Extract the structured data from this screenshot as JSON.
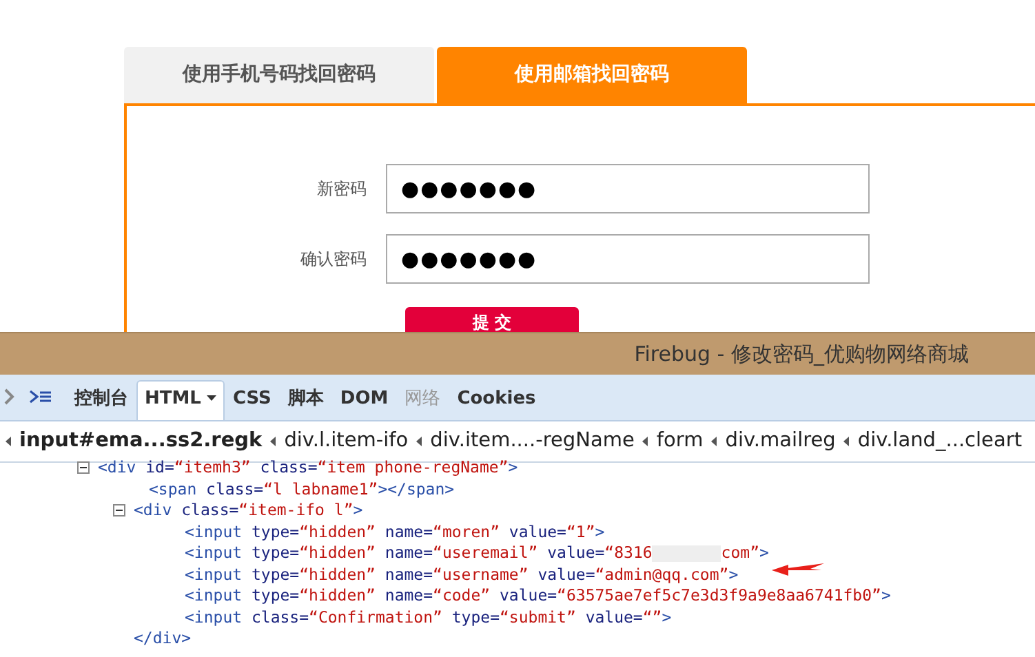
{
  "page": {
    "tabs": [
      {
        "label": "使用手机号码找回密码",
        "selected": false
      },
      {
        "label": "使用邮箱找回密码",
        "selected": true
      }
    ],
    "fields": [
      {
        "label": "新密码",
        "value": "●●●●●●●"
      },
      {
        "label": "确认密码",
        "value": "●●●●●●●"
      }
    ],
    "submit_button": {
      "label": "提 交"
    }
  },
  "firebug": {
    "title": "Firebug - 修改密码_优购物网络商城",
    "tabs": [
      {
        "label": "控制台",
        "selected": false,
        "disabled": false,
        "dropdown": false
      },
      {
        "label": "HTML",
        "selected": true,
        "disabled": false,
        "dropdown": true
      },
      {
        "label": "CSS",
        "selected": false,
        "disabled": false,
        "dropdown": false
      },
      {
        "label": "脚本",
        "selected": false,
        "disabled": false,
        "dropdown": false
      },
      {
        "label": "DOM",
        "selected": false,
        "disabled": false,
        "dropdown": false
      },
      {
        "label": "网络",
        "selected": false,
        "disabled": true,
        "dropdown": false
      },
      {
        "label": "Cookies",
        "selected": false,
        "disabled": false,
        "dropdown": false
      }
    ],
    "breadcrumbs": [
      {
        "label": "input#ema...ss2.regk",
        "selected": true
      },
      {
        "label": "div.l.item-ifo",
        "selected": false
      },
      {
        "label": "div.item....-regName",
        "selected": false
      },
      {
        "label": "form",
        "selected": false
      },
      {
        "label": "div.mailreg",
        "selected": false
      },
      {
        "label": "div.land_...cleart",
        "selected": false
      }
    ],
    "html_tree": [
      {
        "expanded": true,
        "parts": [
          {
            "kind": "tag",
            "text": "<div"
          },
          {
            "kind": "attr",
            "text": " id="
          },
          {
            "kind": "value",
            "text": "“itemh3”"
          },
          {
            "kind": "attr",
            "text": " class="
          },
          {
            "kind": "value",
            "text": "“item phone-regName”"
          },
          {
            "kind": "tag",
            "text": ">"
          }
        ],
        "children": [
          {
            "parts": [
              {
                "kind": "tag",
                "text": "<span"
              },
              {
                "kind": "attr",
                "text": " class="
              },
              {
                "kind": "value",
                "text": "“l labname1”"
              },
              {
                "kind": "tag",
                "text": "></span>"
              }
            ]
          },
          {
            "expanded": true,
            "parts": [
              {
                "kind": "tag",
                "text": "<div"
              },
              {
                "kind": "attr",
                "text": " class="
              },
              {
                "kind": "value",
                "text": "“item-ifo l”"
              },
              {
                "kind": "tag",
                "text": ">"
              }
            ],
            "closing": "</div>",
            "children": [
              {
                "parts": [
                  {
                    "kind": "tag",
                    "text": "<input"
                  },
                  {
                    "kind": "attr",
                    "text": " type="
                  },
                  {
                    "kind": "value",
                    "text": "“hidden”"
                  },
                  {
                    "kind": "attr",
                    "text": " name="
                  },
                  {
                    "kind": "value",
                    "text": "“moren”"
                  },
                  {
                    "kind": "attr",
                    "text": " value="
                  },
                  {
                    "kind": "value",
                    "text": "“1”"
                  },
                  {
                    "kind": "tag",
                    "text": ">"
                  }
                ]
              },
              {
                "parts": [
                  {
                    "kind": "tag",
                    "text": "<input"
                  },
                  {
                    "kind": "attr",
                    "text": " type="
                  },
                  {
                    "kind": "value",
                    "text": "“hidden”"
                  },
                  {
                    "kind": "attr",
                    "text": " name="
                  },
                  {
                    "kind": "value",
                    "text": "“useremail”"
                  },
                  {
                    "kind": "attr",
                    "text": " value="
                  },
                  {
                    "kind": "value",
                    "text": "“8316"
                  },
                  {
                    "kind": "redacted"
                  },
                  {
                    "kind": "value",
                    "text": "com”"
                  },
                  {
                    "kind": "tag",
                    "text": ">"
                  }
                ]
              },
              {
                "marked": true,
                "parts": [
                  {
                    "kind": "tag",
                    "text": "<input"
                  },
                  {
                    "kind": "attr",
                    "text": " type="
                  },
                  {
                    "kind": "value",
                    "text": "“hidden”"
                  },
                  {
                    "kind": "attr",
                    "text": " name="
                  },
                  {
                    "kind": "value",
                    "text": "“username”"
                  },
                  {
                    "kind": "attr",
                    "text": " value="
                  },
                  {
                    "kind": "value",
                    "text": "“admin@qq.com”"
                  },
                  {
                    "kind": "tag",
                    "text": ">"
                  }
                ]
              },
              {
                "parts": [
                  {
                    "kind": "tag",
                    "text": "<input"
                  },
                  {
                    "kind": "attr",
                    "text": " type="
                  },
                  {
                    "kind": "value",
                    "text": "“hidden”"
                  },
                  {
                    "kind": "attr",
                    "text": " name="
                  },
                  {
                    "kind": "value",
                    "text": "“code”"
                  },
                  {
                    "kind": "attr",
                    "text": " value="
                  },
                  {
                    "kind": "value",
                    "text": "“63575ae7ef5c7e3d3f9a9e8aa6741fb0”"
                  },
                  {
                    "kind": "tag",
                    "text": ">"
                  }
                ]
              },
              {
                "parts": [
                  {
                    "kind": "tag",
                    "text": "<input"
                  },
                  {
                    "kind": "attr",
                    "text": " class="
                  },
                  {
                    "kind": "value",
                    "text": "“Confirmation”"
                  },
                  {
                    "kind": "attr",
                    "text": " type="
                  },
                  {
                    "kind": "value",
                    "text": "“submit”"
                  },
                  {
                    "kind": "attr",
                    "text": " value="
                  },
                  {
                    "kind": "value",
                    "text": "“”"
                  },
                  {
                    "kind": "tag",
                    "text": ">"
                  }
                ]
              }
            ]
          }
        ]
      }
    ]
  }
}
